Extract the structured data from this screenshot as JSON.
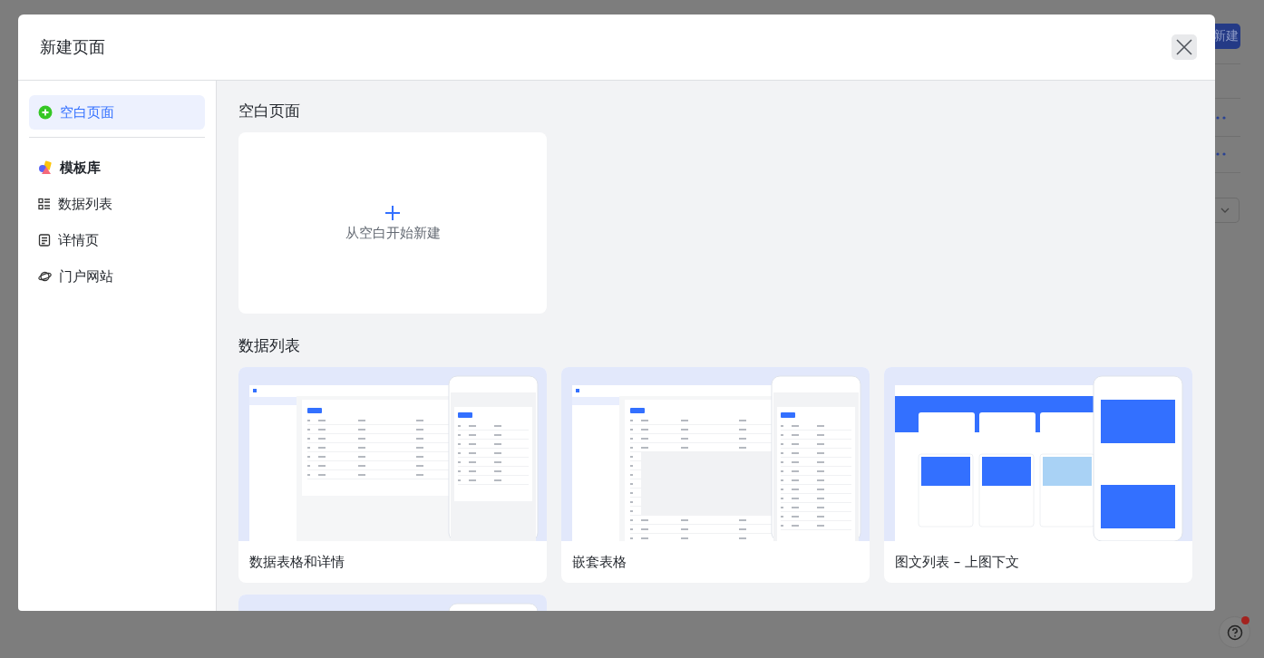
{
  "background": {
    "button": "新建"
  },
  "dialog": {
    "title": "新建页面"
  },
  "sidebar": {
    "items": [
      {
        "label": "空白页面",
        "kind": "blank",
        "selected": true,
        "divider_after": true
      },
      {
        "label": "模板库",
        "kind": "library",
        "selected": false,
        "divider_after": false
      },
      {
        "label": "数据列表",
        "kind": "list",
        "selected": false,
        "divider_after": false
      },
      {
        "label": "详情页",
        "kind": "detail",
        "selected": false,
        "divider_after": false
      },
      {
        "label": "门户网站",
        "kind": "portal",
        "selected": false,
        "divider_after": false
      }
    ]
  },
  "sections": [
    {
      "title": "空白页面",
      "kind": "blank",
      "card": {
        "label": "从空白开始新建"
      }
    },
    {
      "title": "数据列表",
      "kind": "templates",
      "templates": [
        {
          "title": "数据表格和详情",
          "kind": "table"
        },
        {
          "title": "嵌套表格",
          "kind": "nested"
        },
        {
          "title": "图文列表 – 上图下文",
          "kind": "article"
        },
        {
          "kind": "table"
        }
      ]
    }
  ]
}
